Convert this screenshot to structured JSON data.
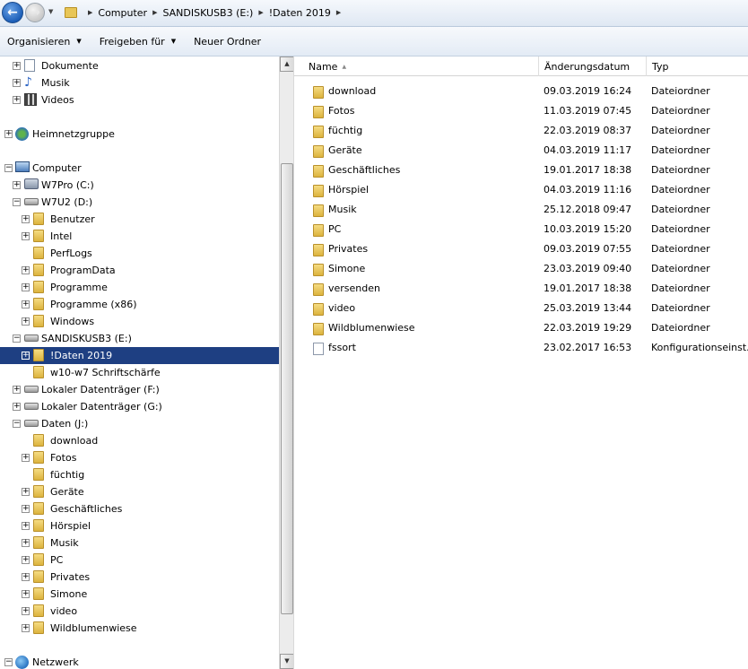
{
  "addressbar": {
    "crumbs": [
      "Computer",
      "SANDISKUSB3 (E:)",
      "!Daten 2019"
    ]
  },
  "toolbar": {
    "organize_label": "Organisieren",
    "share_label": "Freigeben für",
    "new_folder_label": "Neuer Ordner"
  },
  "tree": {
    "items": [
      {
        "label": "Dokumente",
        "icon": "document-icon",
        "expander": "+",
        "level": 2
      },
      {
        "label": "Musik",
        "icon": "music-icon",
        "expander": "+",
        "level": 2
      },
      {
        "label": "Videos",
        "icon": "video-icon",
        "expander": "+",
        "level": 2
      },
      {
        "label": "Heimnetzgruppe",
        "icon": "homegroup-icon",
        "expander": "+",
        "level": 1
      },
      {
        "label": "Computer",
        "icon": "computer-icon",
        "expander": "−",
        "level": 1
      },
      {
        "label": "W7Pro (C:)",
        "icon": "windows-drive-icon",
        "expander": "+",
        "level": 2
      },
      {
        "label": "W7U2 (D:)",
        "icon": "drive-icon",
        "expander": "−",
        "level": 2
      },
      {
        "label": "Benutzer",
        "icon": "folder-icon",
        "expander": "+",
        "level": 3
      },
      {
        "label": "Intel",
        "icon": "folder-icon",
        "expander": "+",
        "level": 3
      },
      {
        "label": "PerfLogs",
        "icon": "folder-icon",
        "expander": "",
        "level": 3
      },
      {
        "label": "ProgramData",
        "icon": "folder-icon",
        "expander": "+",
        "level": 3
      },
      {
        "label": "Programme",
        "icon": "folder-icon",
        "expander": "+",
        "level": 3
      },
      {
        "label": "Programme (x86)",
        "icon": "folder-icon",
        "expander": "+",
        "level": 3
      },
      {
        "label": "Windows",
        "icon": "folder-icon",
        "expander": "+",
        "level": 3
      },
      {
        "label": "SANDISKUSB3 (E:)",
        "icon": "usb-drive-icon",
        "expander": "−",
        "level": 2
      },
      {
        "label": "!Daten 2019",
        "icon": "folder-icon",
        "expander": "+",
        "level": 3,
        "selected": true
      },
      {
        "label": "w10-w7 Schriftschärfe",
        "icon": "folder-icon",
        "expander": "",
        "level": 3
      },
      {
        "label": "Lokaler Datenträger (F:)",
        "icon": "drive-icon",
        "expander": "+",
        "level": 2
      },
      {
        "label": "Lokaler Datenträger (G:)",
        "icon": "drive-icon",
        "expander": "+",
        "level": 2
      },
      {
        "label": "Daten (J:)",
        "icon": "drive-icon",
        "expander": "−",
        "level": 2
      },
      {
        "label": "download",
        "icon": "folder-icon",
        "expander": "",
        "level": 3
      },
      {
        "label": "Fotos",
        "icon": "folder-icon",
        "expander": "+",
        "level": 3
      },
      {
        "label": "füchtig",
        "icon": "folder-icon",
        "expander": "",
        "level": 3
      },
      {
        "label": "Geräte",
        "icon": "folder-icon",
        "expander": "+",
        "level": 3
      },
      {
        "label": "Geschäftliches",
        "icon": "folder-icon",
        "expander": "+",
        "level": 3
      },
      {
        "label": "Hörspiel",
        "icon": "folder-icon",
        "expander": "+",
        "level": 3
      },
      {
        "label": "Musik",
        "icon": "folder-icon",
        "expander": "+",
        "level": 3
      },
      {
        "label": "PC",
        "icon": "folder-icon",
        "expander": "+",
        "level": 3
      },
      {
        "label": "Privates",
        "icon": "folder-icon",
        "expander": "+",
        "level": 3
      },
      {
        "label": "Simone",
        "icon": "folder-icon",
        "expander": "+",
        "level": 3
      },
      {
        "label": "video",
        "icon": "folder-icon",
        "expander": "+",
        "level": 3
      },
      {
        "label": "Wildblumenwiese",
        "icon": "folder-icon",
        "expander": "+",
        "level": 3
      },
      {
        "label": "Netzwerk",
        "icon": "network-icon",
        "expander": "−",
        "level": 1
      }
    ]
  },
  "content": {
    "columns": {
      "name": "Name",
      "date": "Änderungsdatum",
      "type": "Typ"
    },
    "rows": [
      {
        "name": "download",
        "date": "09.03.2019 16:24",
        "type": "Dateiordner",
        "icon": "folder-icon"
      },
      {
        "name": "Fotos",
        "date": "11.03.2019 07:45",
        "type": "Dateiordner",
        "icon": "folder-icon"
      },
      {
        "name": "füchtig",
        "date": "22.03.2019 08:37",
        "type": "Dateiordner",
        "icon": "folder-icon"
      },
      {
        "name": "Geräte",
        "date": "04.03.2019 11:17",
        "type": "Dateiordner",
        "icon": "folder-icon"
      },
      {
        "name": "Geschäftliches",
        "date": "19.01.2017 18:38",
        "type": "Dateiordner",
        "icon": "folder-icon"
      },
      {
        "name": "Hörspiel",
        "date": "04.03.2019 11:16",
        "type": "Dateiordner",
        "icon": "folder-icon"
      },
      {
        "name": "Musik",
        "date": "25.12.2018 09:47",
        "type": "Dateiordner",
        "icon": "folder-icon"
      },
      {
        "name": "PC",
        "date": "10.03.2019 15:20",
        "type": "Dateiordner",
        "icon": "folder-icon"
      },
      {
        "name": "Privates",
        "date": "09.03.2019 07:55",
        "type": "Dateiordner",
        "icon": "folder-icon"
      },
      {
        "name": "Simone",
        "date": "23.03.2019 09:40",
        "type": "Dateiordner",
        "icon": "folder-icon"
      },
      {
        "name": "versenden",
        "date": "19.01.2017 18:38",
        "type": "Dateiordner",
        "icon": "folder-icon"
      },
      {
        "name": "video",
        "date": "25.03.2019 13:44",
        "type": "Dateiordner",
        "icon": "folder-icon"
      },
      {
        "name": "Wildblumenwiese",
        "date": "22.03.2019 19:29",
        "type": "Dateiordner",
        "icon": "folder-icon"
      },
      {
        "name": "fssort",
        "date": "23.02.2017 16:53",
        "type": "Konfigurationseinst...",
        "icon": "config-file-icon"
      }
    ]
  }
}
